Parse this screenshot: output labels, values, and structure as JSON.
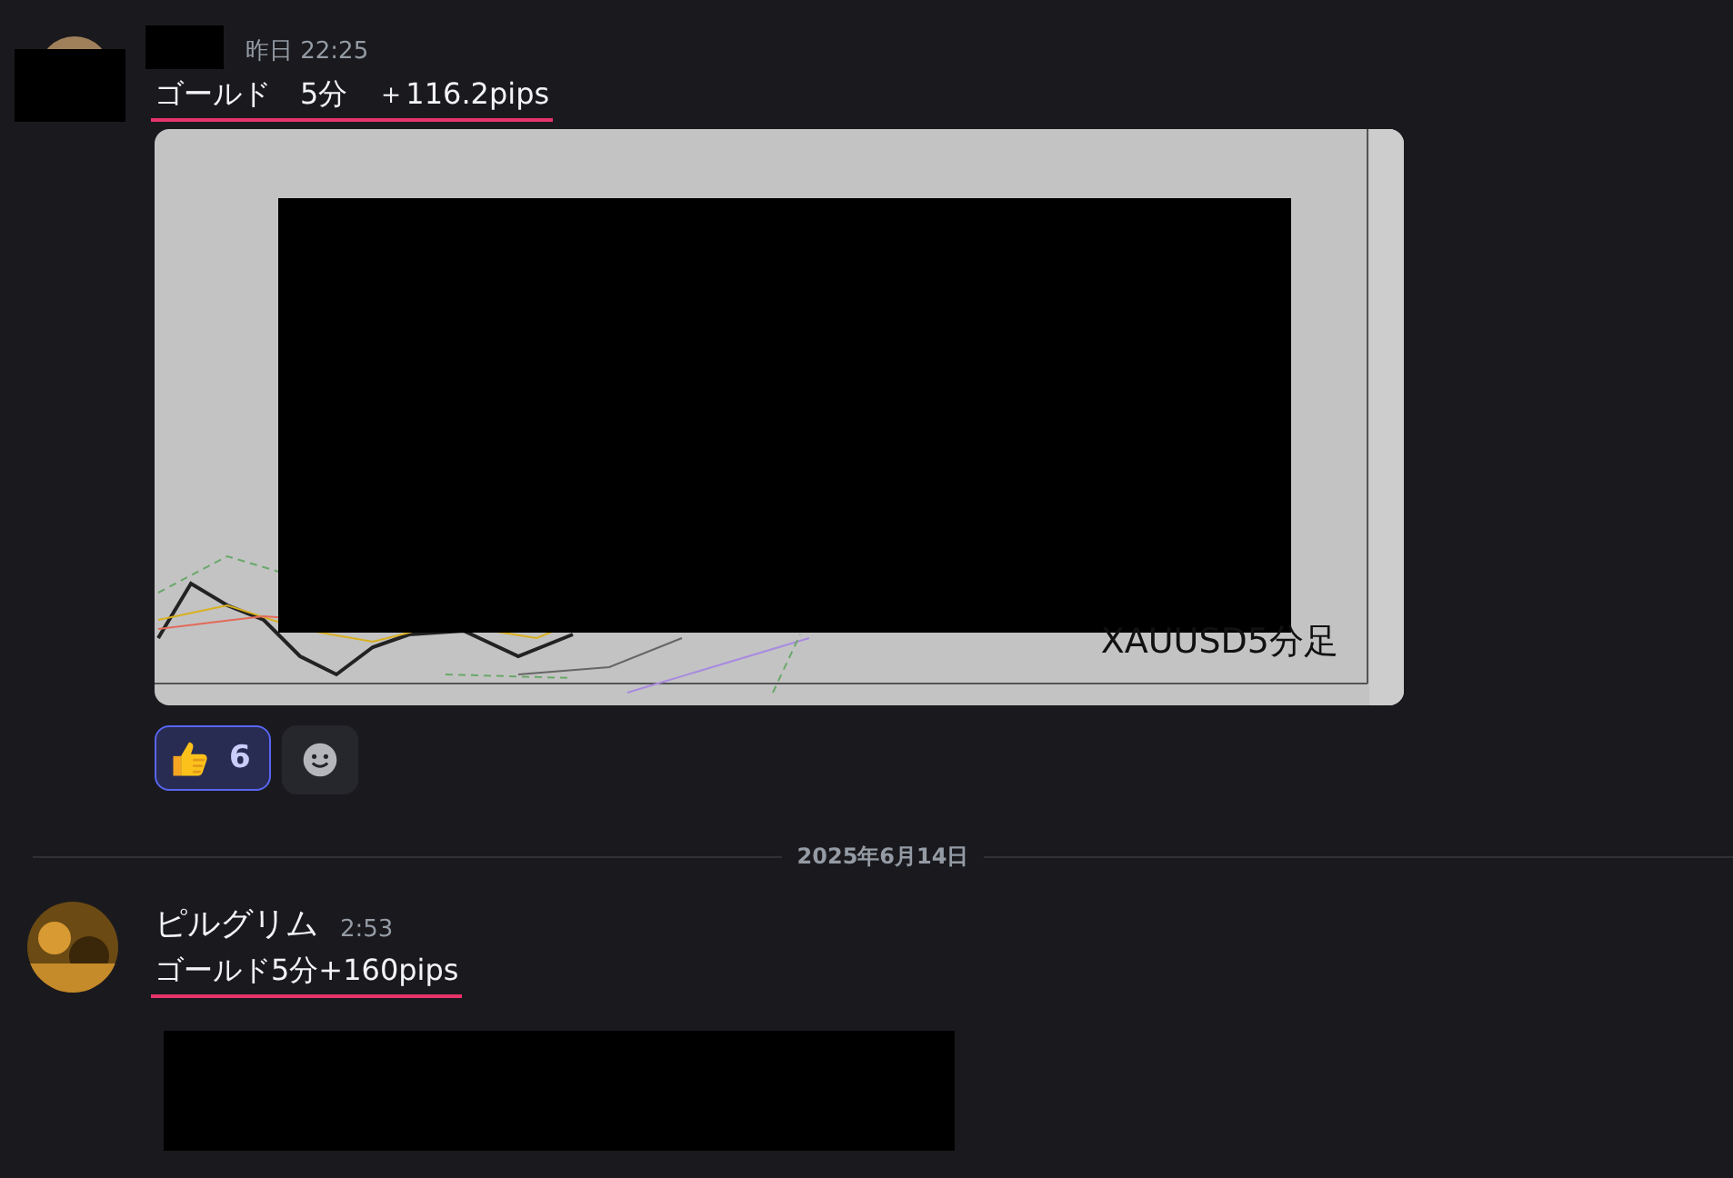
{
  "messages": [
    {
      "time": "昨日 22:25",
      "text": "ゴールド　5分　＋116.2pips",
      "underlined": true,
      "attachment": {
        "kind": "picture",
        "caption": "XAUUSD5分足"
      },
      "reactions": [
        {
          "count": "6",
          "selected": true
        }
      ]
    },
    {
      "date_divider": "2025年6月14日",
      "author": "ピルグリム",
      "time": "2:53",
      "text": "ゴールド5分+160pips",
      "underlined": true
    }
  ]
}
